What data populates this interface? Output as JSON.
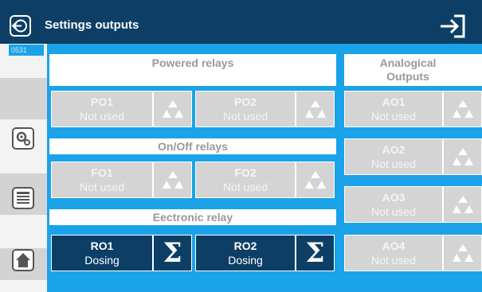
{
  "header": {
    "title": "Settings outputs",
    "back_icon": "back-icon",
    "exit_icon": "exit-icon"
  },
  "sidebar": {
    "code": "0531",
    "items": [
      {
        "icon": "gear-settings-icon"
      },
      {
        "icon": "menu-list-icon"
      },
      {
        "icon": "home-icon"
      }
    ]
  },
  "sections": {
    "powered": {
      "title": "Powered relays",
      "tiles": [
        {
          "name": "PO1",
          "status": "Not used",
          "icon": "recycle-icon"
        },
        {
          "name": "PO2",
          "status": "Not used",
          "icon": "recycle-icon"
        }
      ]
    },
    "onoff": {
      "title": "On/Off relays",
      "tiles": [
        {
          "name": "FO1",
          "status": "Not used",
          "icon": "recycle-icon"
        },
        {
          "name": "FO2",
          "status": "Not used",
          "icon": "recycle-icon"
        }
      ]
    },
    "electronic": {
      "title": "Eectronic relay",
      "tiles": [
        {
          "name": "RO1",
          "status": "Dosing",
          "icon": "sigma-icon",
          "symbol": "Σ"
        },
        {
          "name": "RO2",
          "status": "Dosing",
          "icon": "sigma-icon",
          "symbol": "Σ"
        }
      ]
    },
    "analog": {
      "title": "Analogical Outputs",
      "tiles": [
        {
          "name": "AO1",
          "status": "Not used",
          "icon": "recycle-icon"
        },
        {
          "name": "AO2",
          "status": "Not used",
          "icon": "recycle-icon"
        },
        {
          "name": "AO3",
          "status": "Not used",
          "icon": "recycle-icon"
        },
        {
          "name": "AO4",
          "status": "Not used",
          "icon": "recycle-icon"
        }
      ]
    }
  }
}
